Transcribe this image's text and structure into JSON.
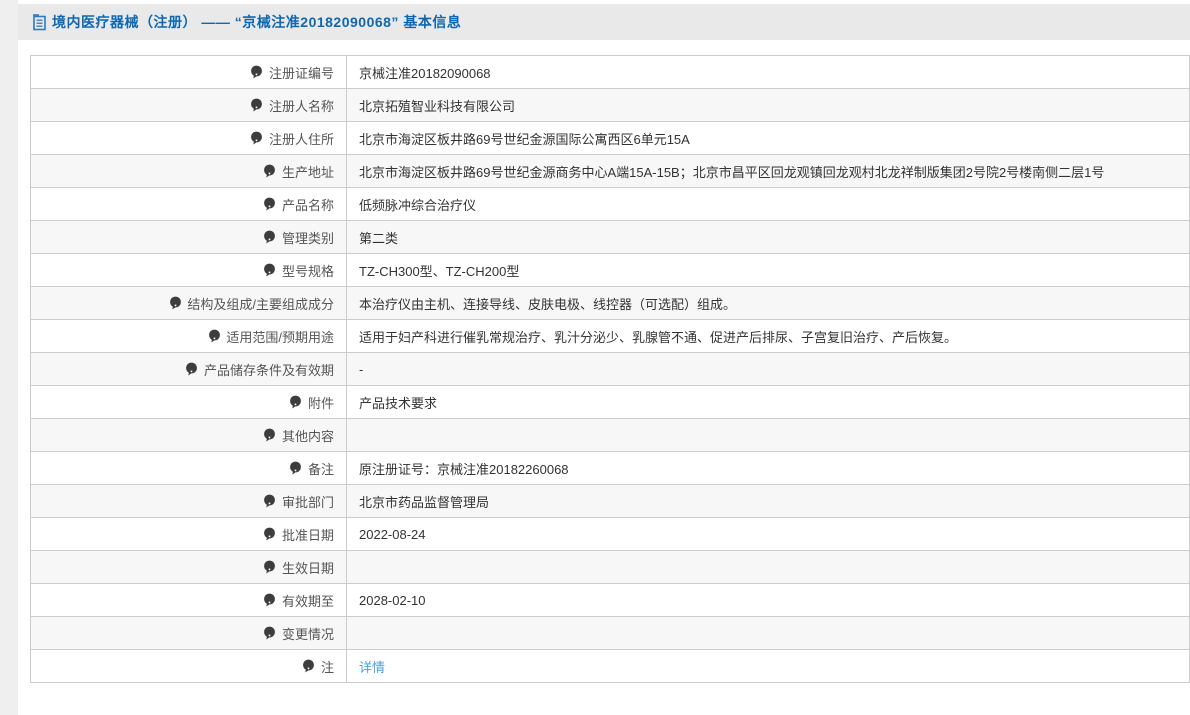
{
  "header": {
    "title": "境内医疗器械（注册） —— “京械注准20182090068” 基本信息"
  },
  "table": {
    "rows": [
      {
        "label": "注册证编号",
        "value": "京械注准20182090068"
      },
      {
        "label": "注册人名称",
        "value": "北京拓殖智业科技有限公司"
      },
      {
        "label": "注册人住所",
        "value": "北京市海淀区板井路69号世纪金源国际公寓西区6单元15A"
      },
      {
        "label": "生产地址",
        "value": "北京市海淀区板井路69号世纪金源商务中心A端15A-15B；北京市昌平区回龙观镇回龙观村北龙祥制版集团2号院2号楼南侧二层1号"
      },
      {
        "label": "产品名称",
        "value": "低频脉冲综合治疗仪"
      },
      {
        "label": "管理类别",
        "value": "第二类"
      },
      {
        "label": "型号规格",
        "value": "TZ-CH300型、TZ-CH200型"
      },
      {
        "label": "结构及组成/主要组成成分",
        "value": "本治疗仪由主机、连接导线、皮肤电极、线控器（可选配）组成。"
      },
      {
        "label": "适用范围/预期用途",
        "value": "适用于妇产科进行催乳常规治疗、乳汁分泌少、乳腺管不通、促进产后排尿、子宫复旧治疗、产后恢复。"
      },
      {
        "label": "产品储存条件及有效期",
        "value": "-"
      },
      {
        "label": "附件",
        "value": "产品技术要求"
      },
      {
        "label": "其他内容",
        "value": ""
      },
      {
        "label": "备注",
        "value": "原注册证号：京械注准20182260068"
      },
      {
        "label": "审批部门",
        "value": "北京市药品监督管理局"
      },
      {
        "label": "批准日期",
        "value": "2022-08-24"
      },
      {
        "label": "生效日期",
        "value": ""
      },
      {
        "label": "有效期至",
        "value": "2028-02-10"
      },
      {
        "label": "变更情况",
        "value": ""
      },
      {
        "label": "注",
        "value": "详情",
        "has_note_icon": true,
        "is_link": true
      }
    ]
  },
  "colors": {
    "title_blue": "#0d68b1",
    "link_blue": "#4a9fd8",
    "title_bar_bg": "#e9e9e9",
    "stripe_bg": "#f7f7f7",
    "border": "#cccccc",
    "label_text": "#555555",
    "value_text": "#333333"
  }
}
